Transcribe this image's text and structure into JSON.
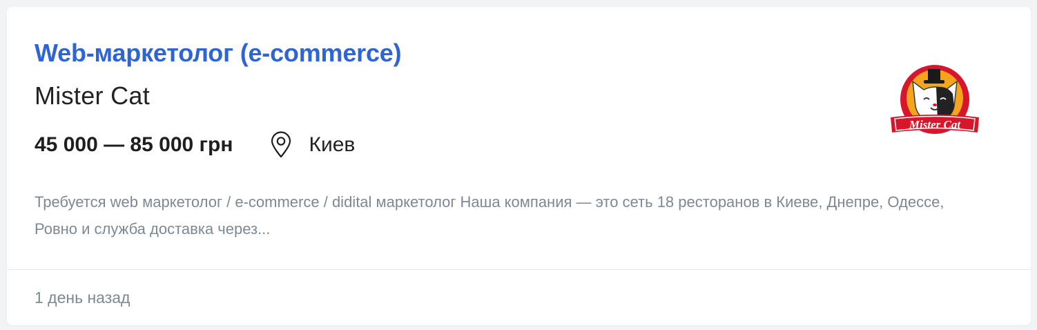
{
  "vacancy": {
    "title": "Web-маркетолог (e-commerce)",
    "company": "Mister Cat",
    "salary": "45 000 — 85 000 грн",
    "city": "Киев",
    "description": "Требуется web маркетолог / e-commerce / didital маркетолог Наша компания — это сеть 18 ресторанов в Киеве, Днепре, Одессе, Ровно и служба доставка через...",
    "posted": "1 день назад",
    "logo_text": "Mister Cat"
  },
  "icons": {
    "location": "location-pin-icon"
  },
  "colors": {
    "title": "#2f64d4",
    "muted_text": "#7d8894",
    "logo_red": "#d7162b",
    "logo_orange": "#f4a51c"
  }
}
